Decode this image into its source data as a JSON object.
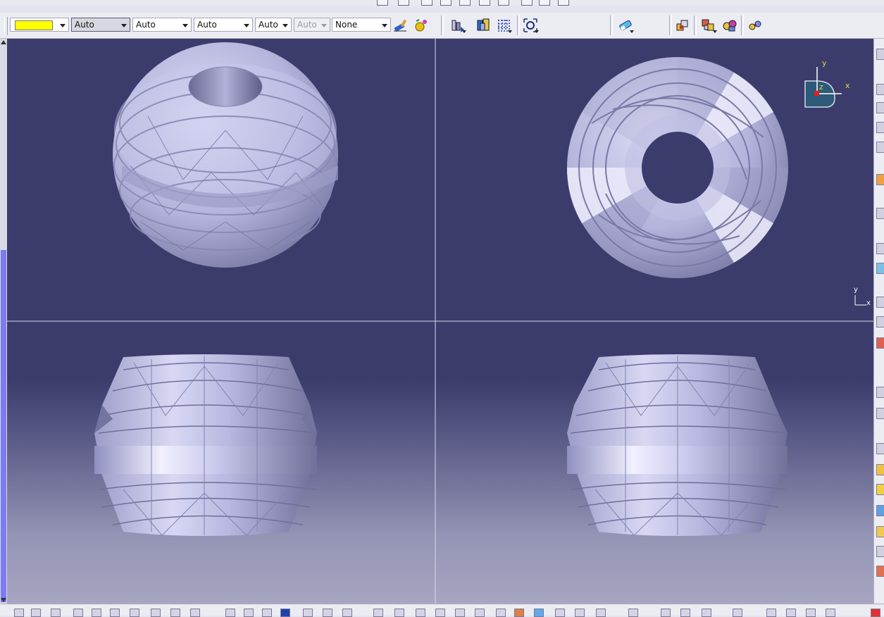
{
  "properties_toolbar": {
    "fill_color": "#ffff00",
    "transparency_value": "Auto",
    "line_thickness_value": "Auto",
    "line_type_value": "Auto",
    "layer_value": "Auto",
    "rendering_value": "Auto",
    "layer_name_value": "None"
  },
  "compass": {
    "x_label": "x",
    "y_label": "y",
    "z_label": "z"
  },
  "axis_triad": {
    "y_label": "y",
    "x_label": "x"
  },
  "colors": {
    "viewport_bg": "#3b3b6c",
    "part_color": "#b8b8e0",
    "compass_marker": "#e8d54a"
  },
  "icons": {
    "toolbar": [
      "paint-brush-icon",
      "painter-icon",
      "fly-mode-icon",
      "multi-view-icon",
      "grid-icon",
      "fit-all-icon",
      "eraser-icon",
      "assembly-icon",
      "explode-icon",
      "constraint-icon",
      "link-icon"
    ]
  }
}
